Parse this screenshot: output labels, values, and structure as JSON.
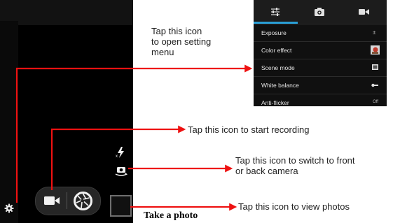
{
  "settings_menu": {
    "tabs": [
      {
        "icon": "sliders-icon"
      },
      {
        "icon": "camera-icon"
      },
      {
        "icon": "video-camera-icon"
      }
    ],
    "rows": [
      {
        "label": "Exposure",
        "icon": "exposure-icon"
      },
      {
        "label": "Color effect",
        "icon": "color-effect-icon"
      },
      {
        "label": "Scene mode",
        "icon": "scene-mode-icon"
      },
      {
        "label": "White balance",
        "icon": "white-balance-icon"
      },
      {
        "label": "Anti-flicker",
        "value": "Off"
      }
    ]
  },
  "annotations": {
    "settings": "Tap this icon\nto open setting\nmenu",
    "record": "Tap this icon to start recording",
    "switch_camera": "Tap this icon to switch to front\nor back camera",
    "view_photos": "Tap this icon to view photos",
    "take_photo": "Take a photo"
  },
  "colors": {
    "arrow": "#ee1111",
    "accent": "#2a9fd6"
  }
}
